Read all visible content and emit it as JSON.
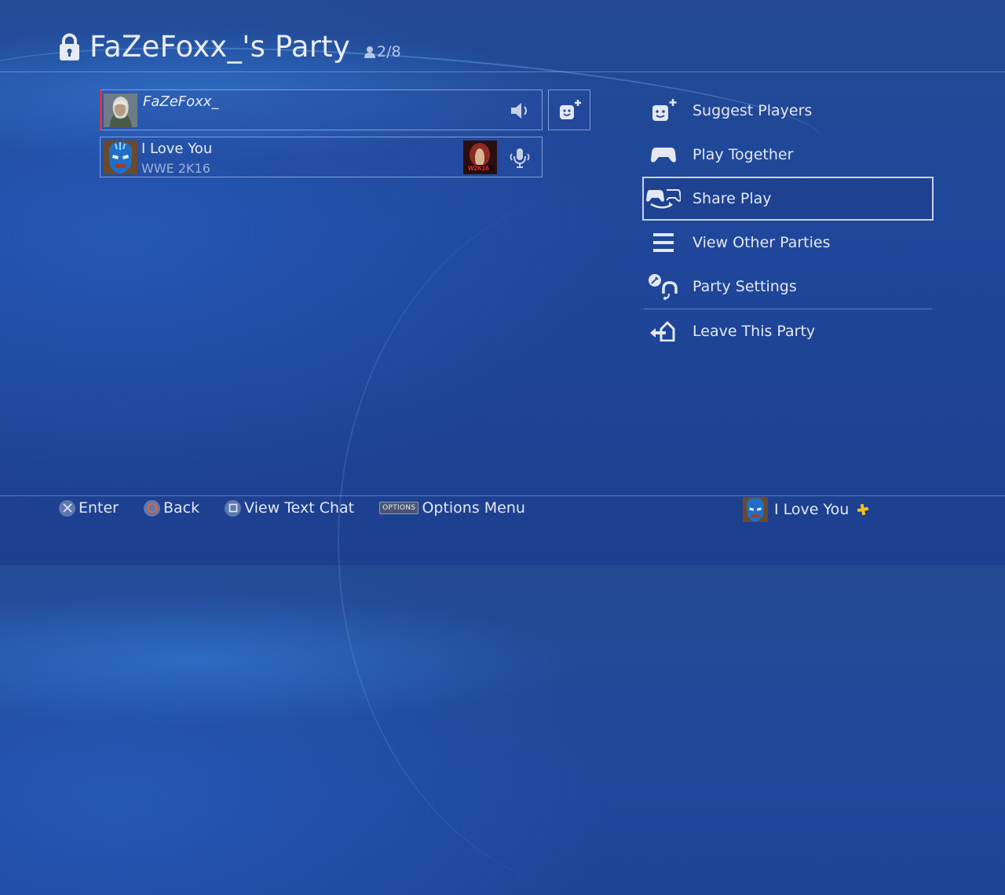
{
  "header": {
    "title": "FaZeFoxx_'s Party",
    "member_count": "2/8",
    "icons": {
      "lock": "lock-icon",
      "people": "person-icon"
    }
  },
  "members": [
    {
      "name": "FaZeFoxx_",
      "subtitle": "",
      "is_self": true,
      "status_icon": "speaker-icon",
      "avatar": "witcher-avatar"
    },
    {
      "name": "I Love You",
      "subtitle": "WWE 2K16",
      "is_self": false,
      "status_icon": "microphone-icon",
      "avatar": "masked-wrestler-avatar",
      "game_thumbnail": "wwe-2k16-thumbnail"
    }
  ],
  "invite_button": {
    "icon": "add-player-icon"
  },
  "menu": {
    "items": [
      {
        "label": "Suggest Players",
        "icon": "add-player-icon"
      },
      {
        "label": "Play Together",
        "icon": "controller-icon"
      },
      {
        "label": "Share Play",
        "icon": "share-play-icon",
        "selected": true
      },
      {
        "label": "View Other Parties",
        "icon": "list-icon"
      },
      {
        "label": "Party Settings",
        "icon": "settings-headset-icon"
      },
      {
        "label": "Leave This Party",
        "icon": "leave-icon"
      }
    ]
  },
  "footer": {
    "hints": [
      {
        "button": "cross",
        "label": "Enter"
      },
      {
        "button": "circle",
        "label": "Back"
      },
      {
        "button": "square",
        "label": "View Text Chat"
      },
      {
        "button": "OPTIONS",
        "label": "Options Menu"
      }
    ],
    "user": {
      "name": "I Love You",
      "badge": "playstation-plus-icon"
    }
  },
  "colors": {
    "background": "#1f479b",
    "self_indicator": "#e0313b",
    "text": "#e3e8f4",
    "plus_badge": "#f2c21b",
    "circle_button": "#e2643c"
  }
}
